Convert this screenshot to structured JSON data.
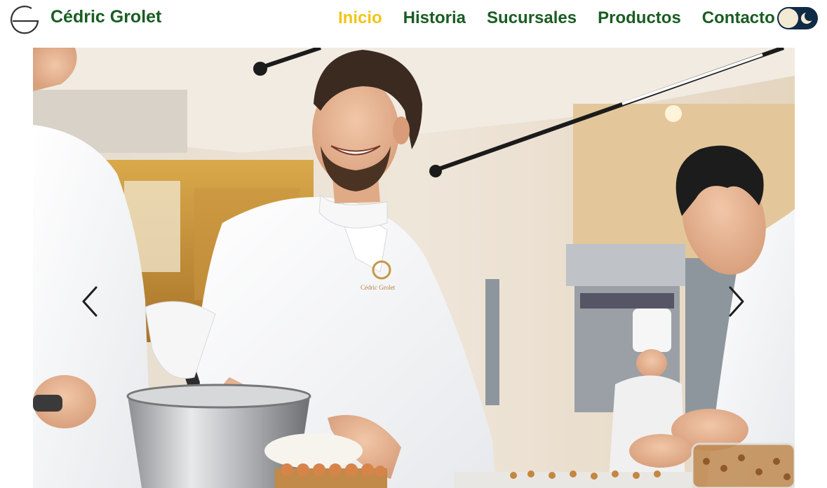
{
  "brand": {
    "name": "Cédric Grolet",
    "logo_icon": "cg-logo-icon"
  },
  "nav": {
    "items": [
      {
        "label": "Inicio",
        "active": true
      },
      {
        "label": "Historia",
        "active": false
      },
      {
        "label": "Sucursales",
        "active": false
      },
      {
        "label": "Productos",
        "active": false
      },
      {
        "label": "Contacto",
        "active": false
      }
    ]
  },
  "theme_toggle": {
    "icon": "moon-icon",
    "state": "light"
  },
  "hero": {
    "jacket_embroidery": "Cédric Grolet",
    "prev_icon": "chevron-left-icon",
    "next_icon": "chevron-right-icon"
  },
  "colors": {
    "brand_green": "#1a5c23",
    "active_yellow": "#f2c417",
    "toggle_dark": "#0f2b45"
  }
}
